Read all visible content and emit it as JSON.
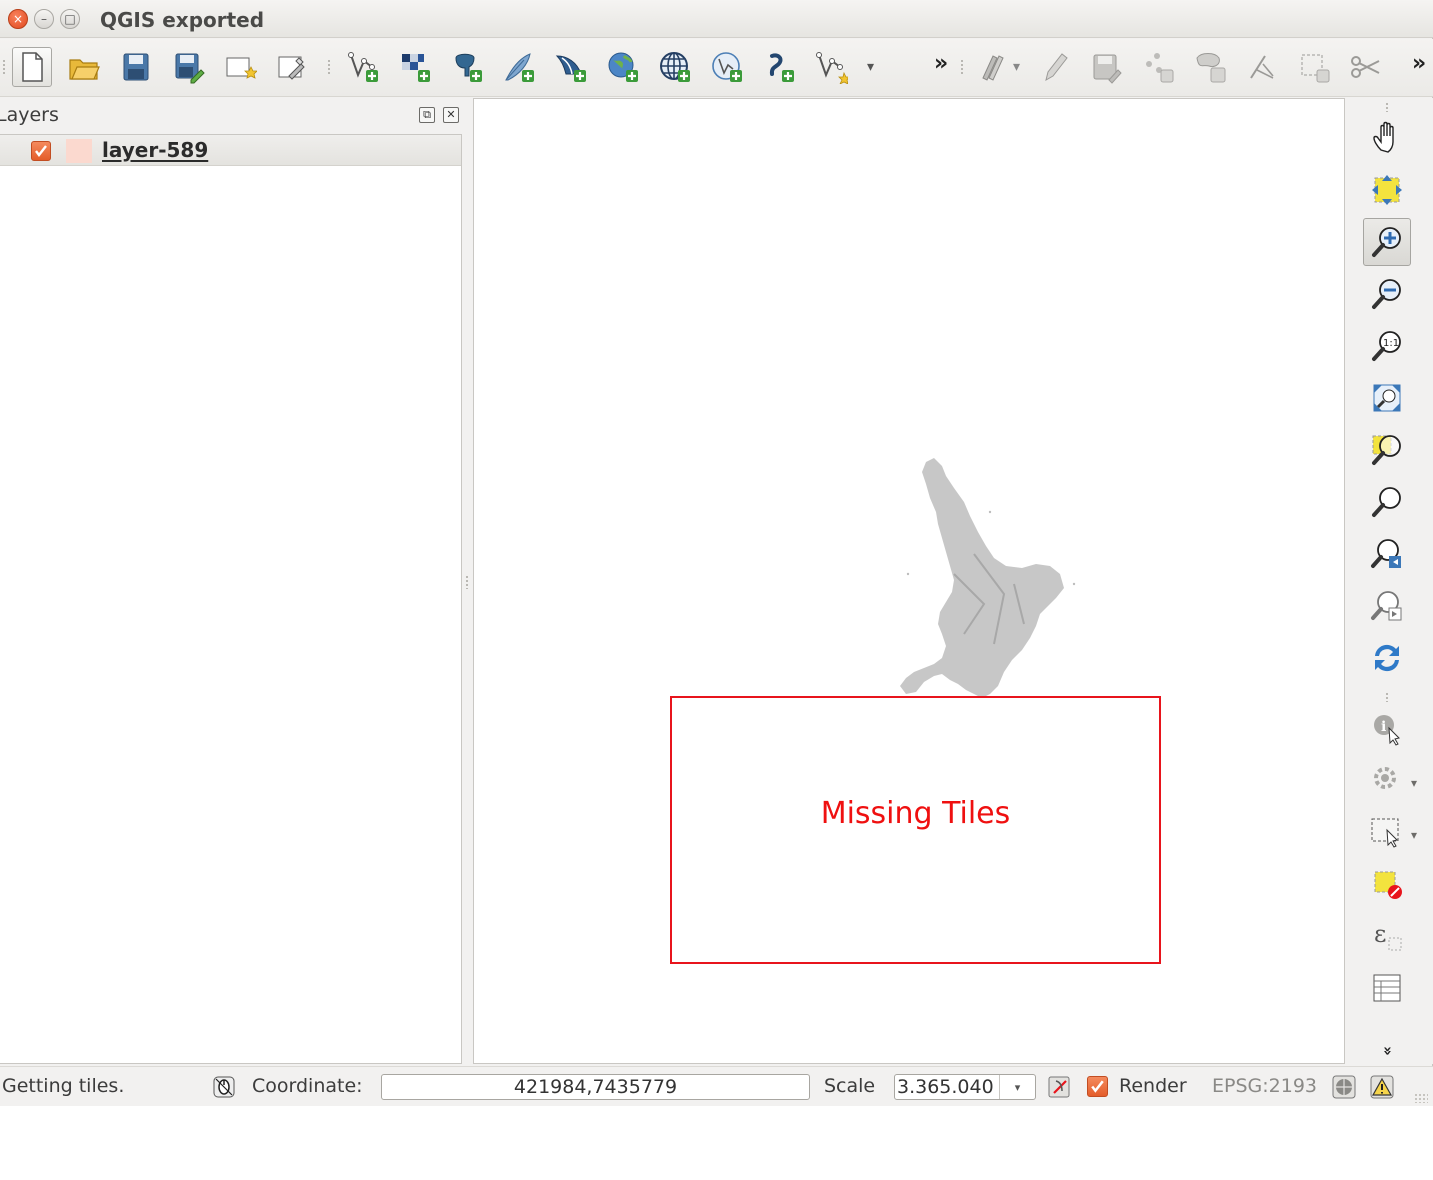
{
  "window": {
    "title": "QGIS exported",
    "close_glyph": "×",
    "min_glyph": "–",
    "max_glyph": "□"
  },
  "toolbar": {
    "icons": [
      "new-project-icon",
      "open-project-icon",
      "save-project-icon",
      "save-as-icon",
      "new-print-composer-icon",
      "composer-manager-icon",
      "add-vector-layer-icon",
      "add-raster-layer-icon",
      "add-postgis-layer-icon",
      "add-spatialite-layer-icon",
      "add-mssql-layer-icon",
      "add-wms-layer-icon",
      "add-wcs-layer-icon",
      "add-wfs-layer-icon",
      "add-delimited-text-icon",
      "new-shapefile-icon",
      "current-edits-icon",
      "toggle-editing-icon",
      "save-edits-icon",
      "add-feature-icon",
      "move-feature-icon",
      "node-tool-icon",
      "delete-selected-icon",
      "cut-features-icon"
    ],
    "overflow_glyph": "»",
    "dropdown_glyph": "▾"
  },
  "layers_panel": {
    "title": "Layers",
    "float_glyph": "⧉",
    "close_glyph": "✕",
    "layers": [
      {
        "name": "layer-589",
        "visible": true,
        "swatch_color": "#fbd9cf"
      }
    ]
  },
  "map": {
    "missing_tiles_text": "Missing Tiles",
    "box_color": "#e8141c",
    "land_color": "#bdbdbd"
  },
  "right_toolbar": {
    "icons": [
      "pan-icon",
      "pan-to-selection-icon",
      "zoom-in-icon",
      "zoom-out-icon",
      "zoom-native-icon",
      "zoom-full-icon",
      "zoom-to-selection-icon",
      "zoom-to-layer-icon",
      "zoom-last-icon",
      "zoom-next-icon",
      "refresh-icon",
      "identify-icon",
      "run-action-icon",
      "select-features-icon",
      "deselect-icon",
      "select-by-expression-icon",
      "attribute-table-icon"
    ],
    "more_glyph": "»"
  },
  "statusbar": {
    "message": "Getting tiles.",
    "coordinate_label": "Coordinate:",
    "coordinate_value": "421984,7435779",
    "scale_label": "Scale",
    "scale_value": "3.365.040",
    "render_label": "Render",
    "render_checked": true,
    "crs": "EPSG:2193"
  }
}
